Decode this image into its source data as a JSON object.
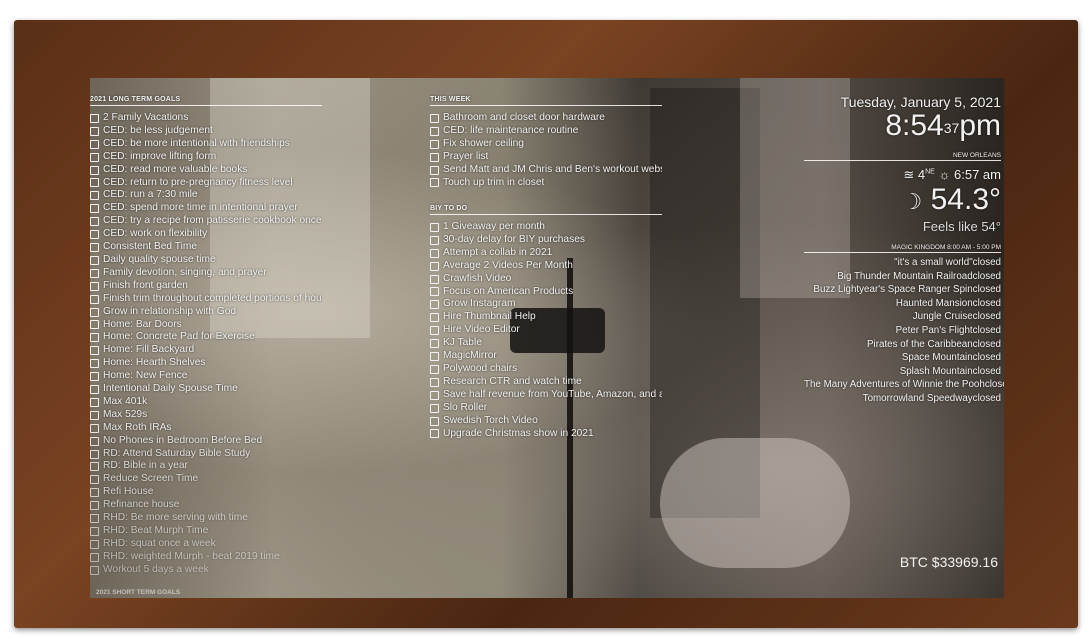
{
  "long_term": {
    "header": "2021 LONG TERM GOALS",
    "items": [
      "2 Family Vacations",
      "CED: be less judgement",
      "CED: be more intentional with friendships",
      "CED: improve lifting form",
      "CED: read more valuable books",
      "CED: return to pre-pregnancy fitness level",
      "CED: run a 7:30 mile",
      "CED: spend more time in intentional prayer",
      "CED: try a recipe from patisserie cookbook once a m...",
      "CED: work on flexibility",
      "Consistent Bed Time",
      "Daily quality spouse time",
      "Family devotion, singing, and prayer",
      "Finish front garden",
      "Finish trim throughout completed portions of house",
      "Grow in relationship with God",
      "Home: Bar Doors",
      "Home: Concrete Pad for Exercise",
      "Home: Fill Backyard",
      "Home: Hearth Shelves",
      "Home: New Fence",
      "Intentional Daily Spouse Time",
      "Max 401k",
      "Max 529s",
      "Max Roth IRAs",
      "No Phones in Bedroom Before Bed",
      "RD: Attend Saturday Bible Study",
      "RD: Bible in a year",
      "Reduce Screen Time",
      "Refi House",
      "Refinance house",
      "RHD: Be more serving with time",
      "RHD: Beat Murph Time",
      "RHD: squat once a week",
      "RHD: weighted Murph - beat 2019 time",
      "Workout 5 days a week"
    ]
  },
  "short_term_header": "2021 SHORT TERM GOALS",
  "this_week": {
    "header": "THIS WEEK",
    "items": [
      "Bathroom and closet door hardware",
      "CED: life maintenance routine",
      "Fix shower ceiling",
      "Prayer list",
      "Send Matt and JM Chris and Ben's workout website",
      "Touch up trim in closet"
    ]
  },
  "biy": {
    "header": "BIY TO DO",
    "items": [
      "1 Giveaway per month",
      "30-day delay for BIY purchases",
      "Attempt a collab in 2021",
      "Average 2 Videos Per Month",
      "Crawfish Video",
      "Focus on American Products",
      "Grow Instagram",
      "Hire Thumbnail Help",
      "Hire Video Editor",
      "KJ Table",
      "MagicMirror",
      "Polywood chairs",
      "Research CTR and watch time",
      "Save half revenue from YouTube, Amazon, and affilia...",
      "Slo Roller",
      "Swedish Torch Video",
      "Upgrade Christmas show in 2021"
    ]
  },
  "clock": {
    "date": "Tuesday, January 5, 2021",
    "time": "8:54",
    "seconds": "37",
    "ampm": "pm"
  },
  "weather": {
    "location": "NEW ORLEANS",
    "wind_speed": "4",
    "wind_dir": "NE",
    "sunrise_time": "6:57 am",
    "temp": "54.3°",
    "feels": "Feels like 54°"
  },
  "park": {
    "header": "MAGIC KINGDOM 8:00 AM - 5:00 PM",
    "rides": [
      {
        "name": "\"it's a small world\"",
        "status": "closed"
      },
      {
        "name": "Big Thunder Mountain Railroad",
        "status": "closed"
      },
      {
        "name": "Buzz Lightyear's Space Ranger Spin",
        "status": "closed"
      },
      {
        "name": "Haunted Mansion",
        "status": "closed"
      },
      {
        "name": "Jungle Cruise",
        "status": "closed"
      },
      {
        "name": "Peter Pan's Flight",
        "status": "closed"
      },
      {
        "name": "Pirates of the Caribbean",
        "status": "closed"
      },
      {
        "name": "Space Mountain",
        "status": "closed"
      },
      {
        "name": "Splash Mountain",
        "status": "closed"
      },
      {
        "name": "The Many Adventures of Winnie the Pooh",
        "status": "closed"
      },
      {
        "name": "Tomorrowland Speedway",
        "status": "closed"
      }
    ]
  },
  "btc": "BTC $33969.16"
}
